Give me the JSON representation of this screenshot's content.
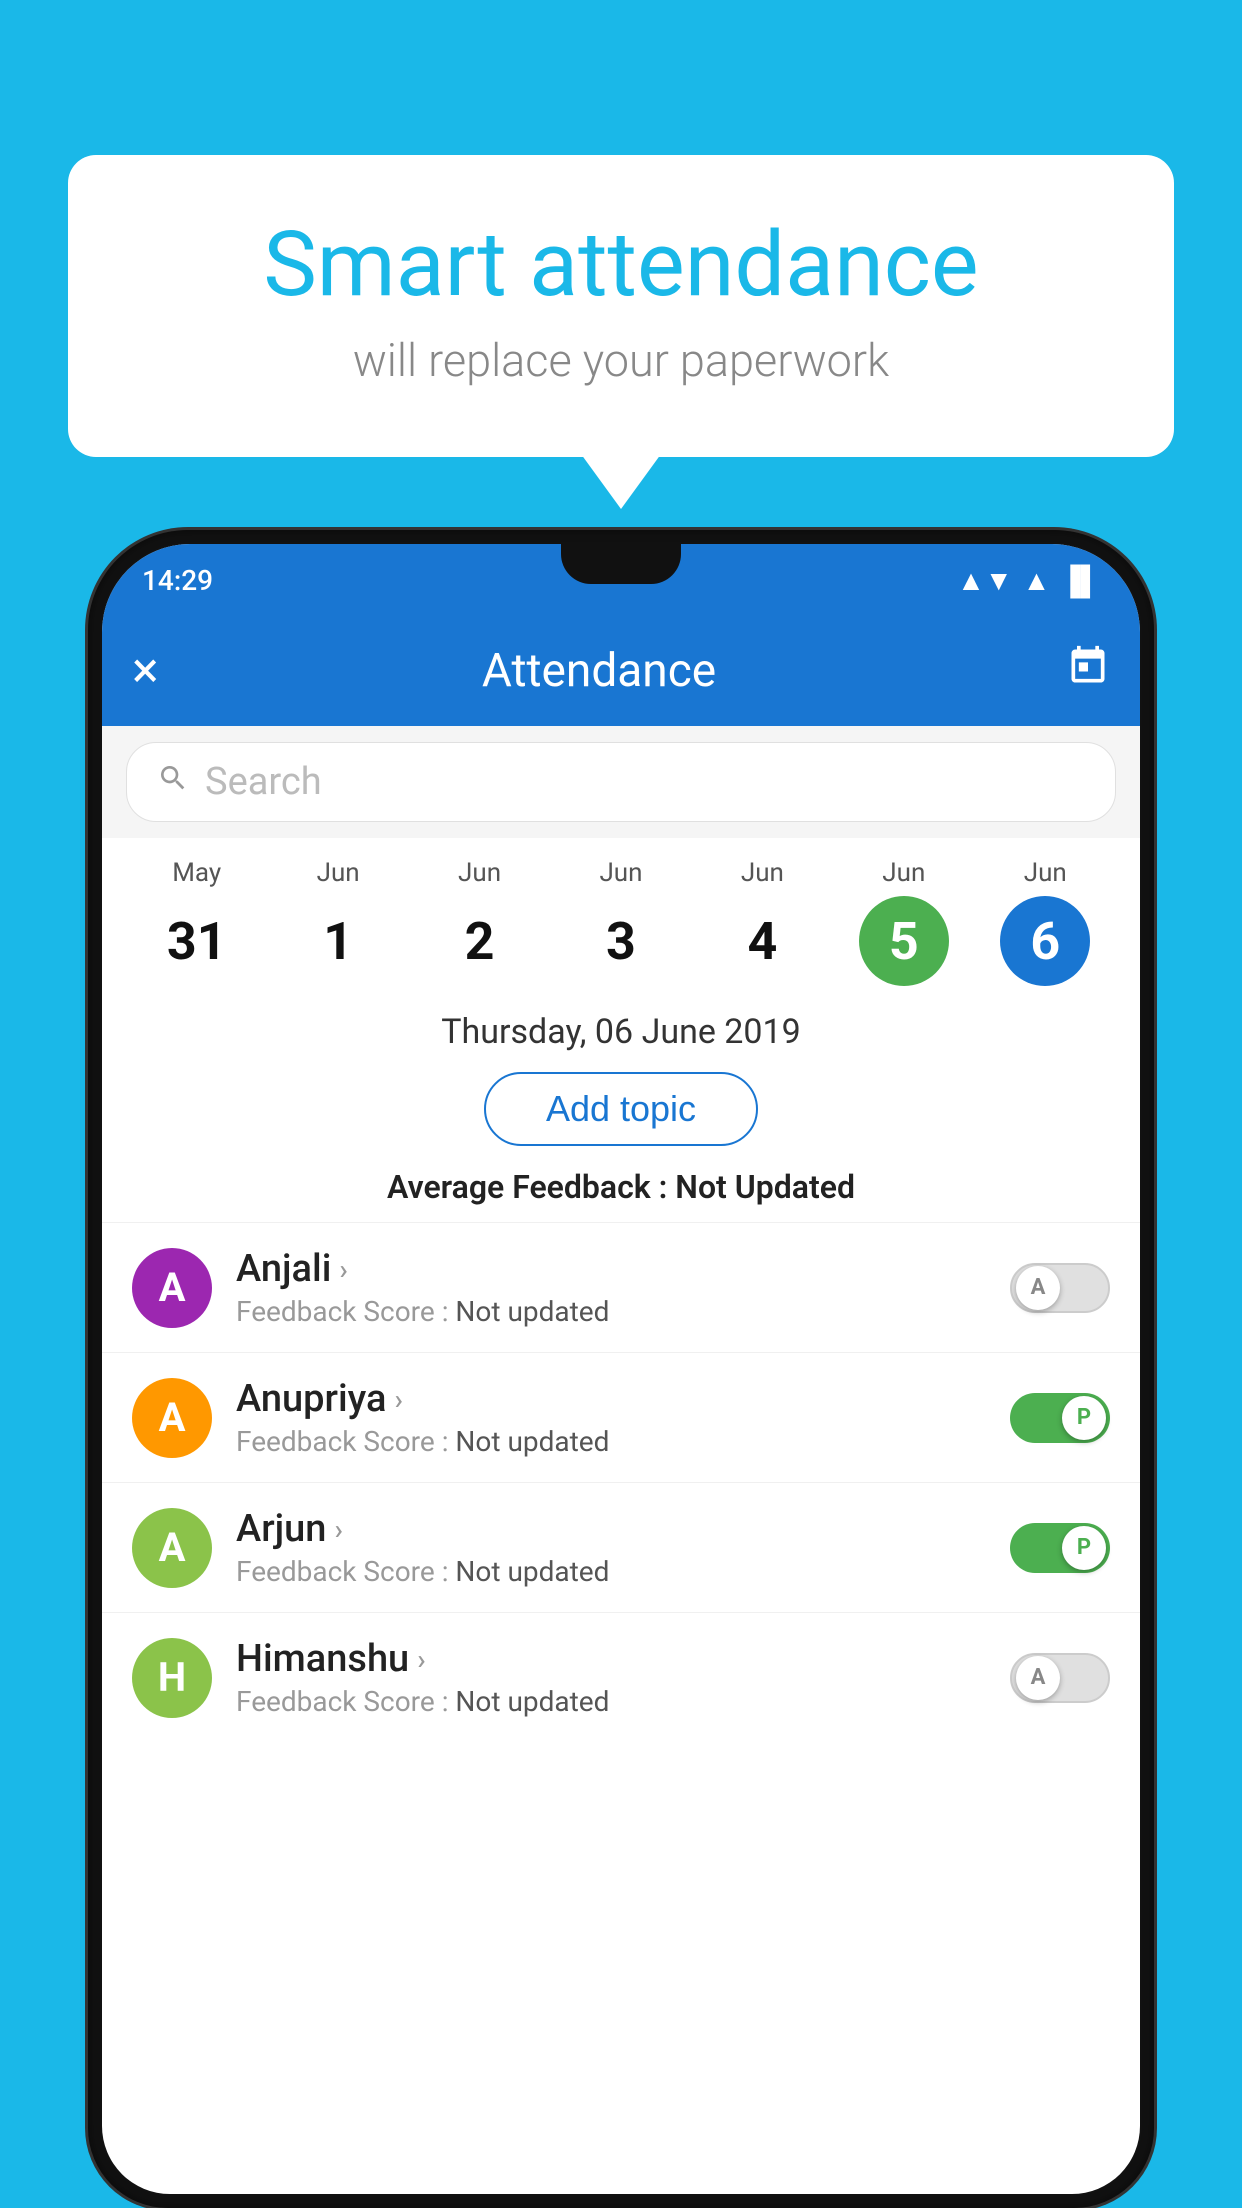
{
  "background_color": "#1ab8e8",
  "speech_bubble": {
    "title": "Smart attendance",
    "subtitle": "will replace your paperwork"
  },
  "status_bar": {
    "time": "14:29",
    "wifi": "▼",
    "signal": "▲",
    "battery": "▐"
  },
  "app_bar": {
    "title": "Attendance",
    "close_label": "×",
    "calendar_icon": "📅"
  },
  "search": {
    "placeholder": "Search"
  },
  "calendar": {
    "days": [
      {
        "month": "May",
        "number": "31",
        "active": false
      },
      {
        "month": "Jun",
        "number": "1",
        "active": false
      },
      {
        "month": "Jun",
        "number": "2",
        "active": false
      },
      {
        "month": "Jun",
        "number": "3",
        "active": false
      },
      {
        "month": "Jun",
        "number": "4",
        "active": false
      },
      {
        "month": "Jun",
        "number": "5",
        "active": "green"
      },
      {
        "month": "Jun",
        "number": "6",
        "active": "blue"
      }
    ]
  },
  "selected_date": "Thursday, 06 June 2019",
  "add_topic_label": "Add topic",
  "avg_feedback_label": "Average Feedback :",
  "avg_feedback_value": "Not Updated",
  "students": [
    {
      "name": "Anjali",
      "avatar_letter": "A",
      "avatar_color": "#9c27b0",
      "feedback_label": "Feedback Score :",
      "feedback_value": "Not updated",
      "toggle_state": "off",
      "toggle_letter": "A"
    },
    {
      "name": "Anupriya",
      "avatar_letter": "A",
      "avatar_color": "#ff9800",
      "feedback_label": "Feedback Score :",
      "feedback_value": "Not updated",
      "toggle_state": "on",
      "toggle_letter": "P"
    },
    {
      "name": "Arjun",
      "avatar_letter": "A",
      "avatar_color": "#8bc34a",
      "feedback_label": "Feedback Score :",
      "feedback_value": "Not updated",
      "toggle_state": "on",
      "toggle_letter": "P"
    },
    {
      "name": "Himanshu",
      "avatar_letter": "H",
      "avatar_color": "#8bc34a",
      "feedback_label": "Feedback Score :",
      "feedback_value": "Not updated",
      "toggle_state": "off",
      "toggle_letter": "A"
    }
  ]
}
